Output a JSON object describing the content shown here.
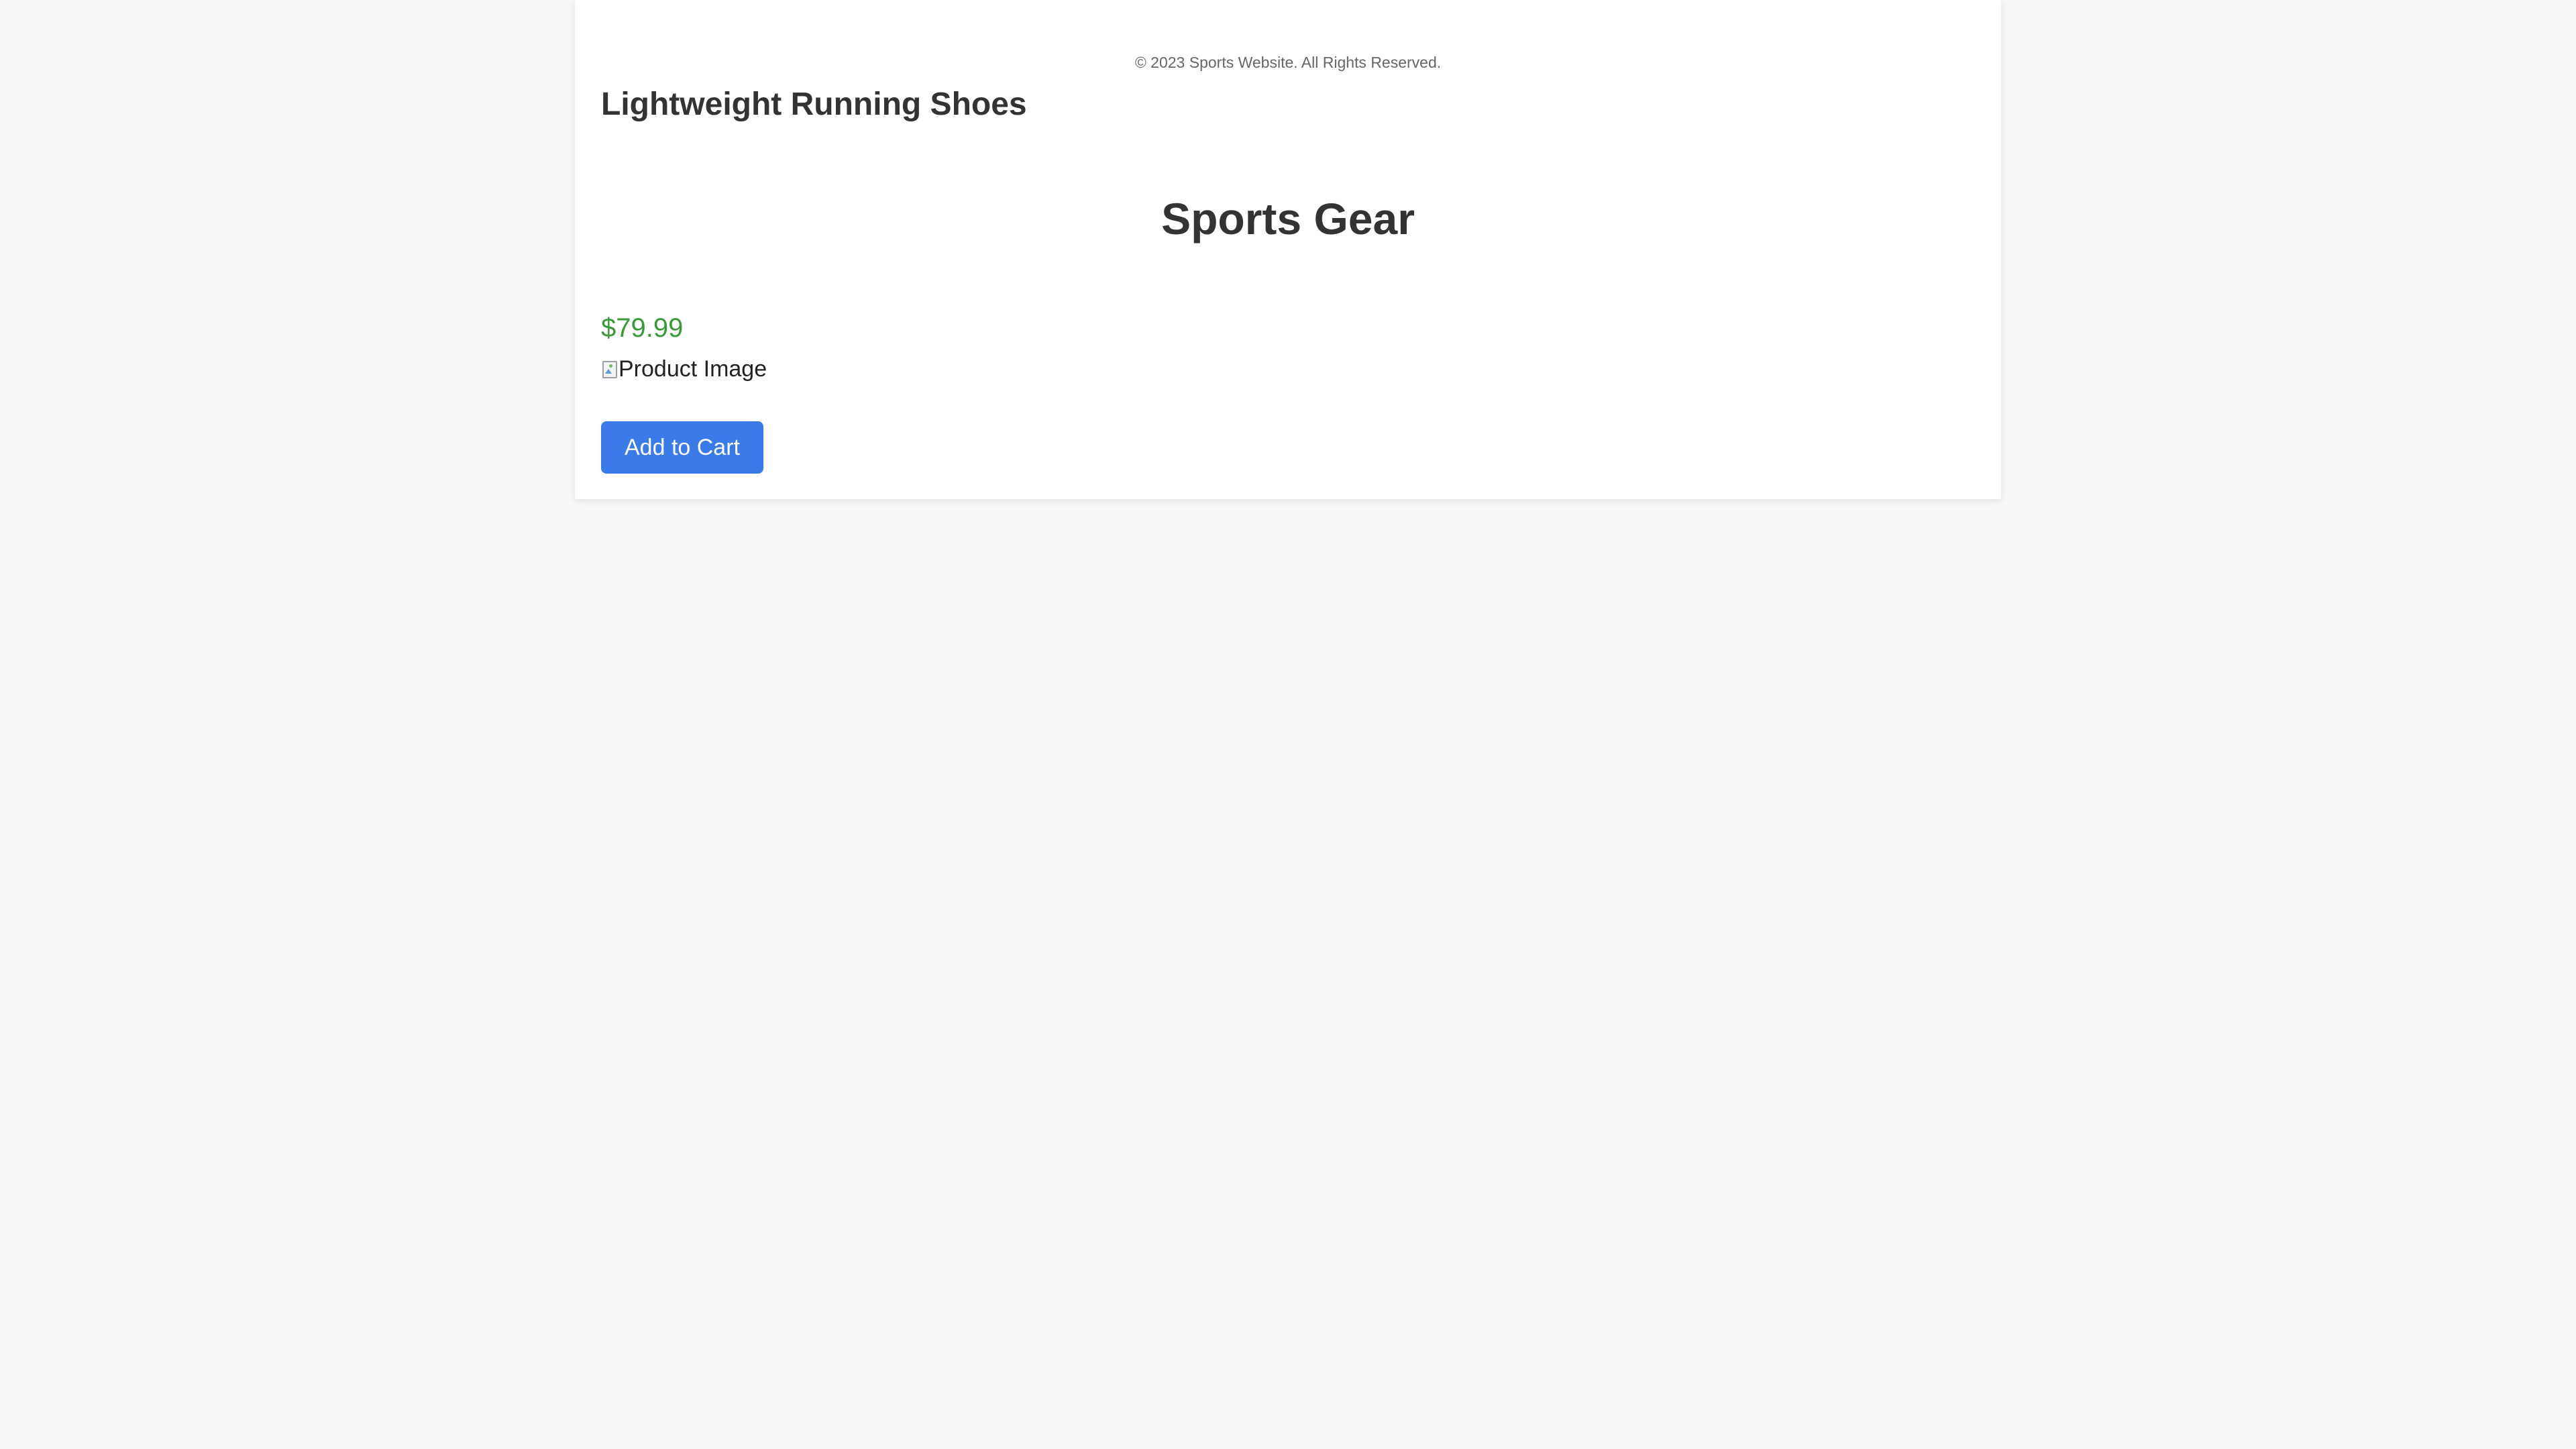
{
  "footer": {
    "copyright": "© 2023 Sports Website. All Rights Reserved."
  },
  "product": {
    "title": "Lightweight Running Shoes",
    "price": "$79.99",
    "image_alt": "Product Image",
    "image_icon": "broken-image-icon",
    "add_to_cart_label": "Add to Cart"
  },
  "site": {
    "heading": "Sports Gear"
  },
  "colors": {
    "page_background": "#f7f7f7",
    "card_background": "#ffffff",
    "price": "#3a9a3a",
    "button": "#3b7be9",
    "heading_text": "#333333"
  }
}
